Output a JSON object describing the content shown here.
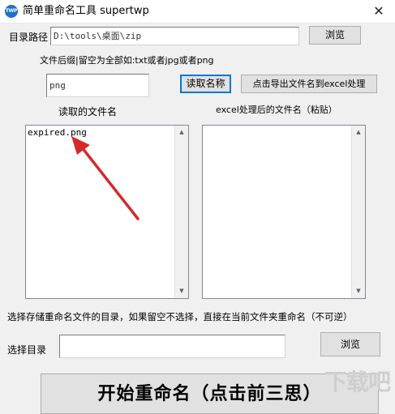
{
  "window": {
    "title": "简单重命名工具 supertwp",
    "icon_text": "TWP",
    "close_glyph": "✕"
  },
  "dir_row": {
    "label": "目录路径",
    "value": "D:\\tools\\桌面\\zip",
    "browse_label": "浏览"
  },
  "suffix": {
    "hint": "文件后缀|留空为全部如:txt或者jpg或者png",
    "value": "png",
    "read_button": "读取名称",
    "export_button": "点击导出文件名到excel处理"
  },
  "read_list": {
    "header": "读取的文件名",
    "items": [
      "expired.png"
    ]
  },
  "excel_list": {
    "header": "excel处理后的文件名（粘贴）",
    "items": []
  },
  "save_dir": {
    "hint": "选择存储重命名文件的目录，如果留空不选择，直接在当前文件夹重命名（不可逆）",
    "label": "选择目录",
    "value": "",
    "browse_label": "浏览"
  },
  "start_button": "开始重命名（点击前三思）",
  "watermark": "下载吧",
  "colors": {
    "arrow": "#d42a2a",
    "icon": "#1e73c8"
  }
}
